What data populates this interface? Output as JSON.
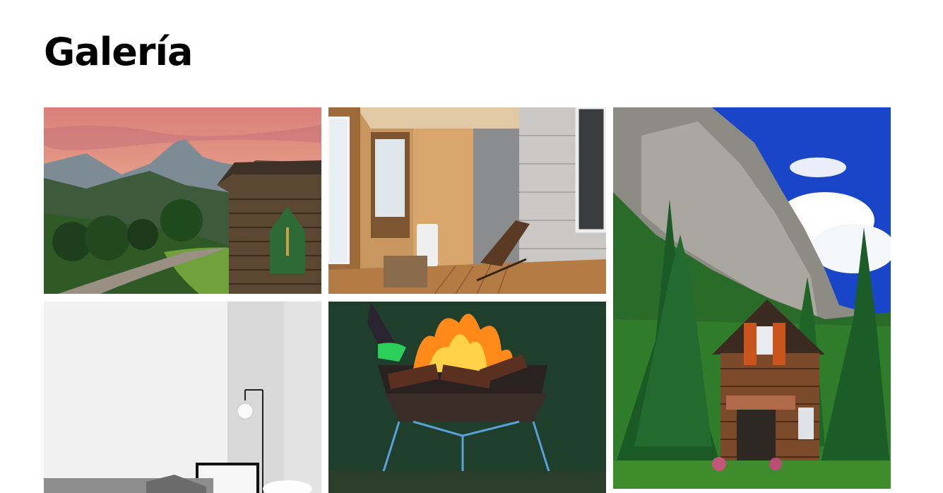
{
  "gallery": {
    "title": "Galería",
    "images": [
      {
        "subject": "log-cabin-mountains-photo"
      },
      {
        "subject": "wooden-porch-interior-photo"
      },
      {
        "subject": "forest-cabin-cliff-photo"
      },
      {
        "subject": "white-living-room-photo"
      },
      {
        "subject": "campfire-brazier-photo"
      }
    ]
  }
}
